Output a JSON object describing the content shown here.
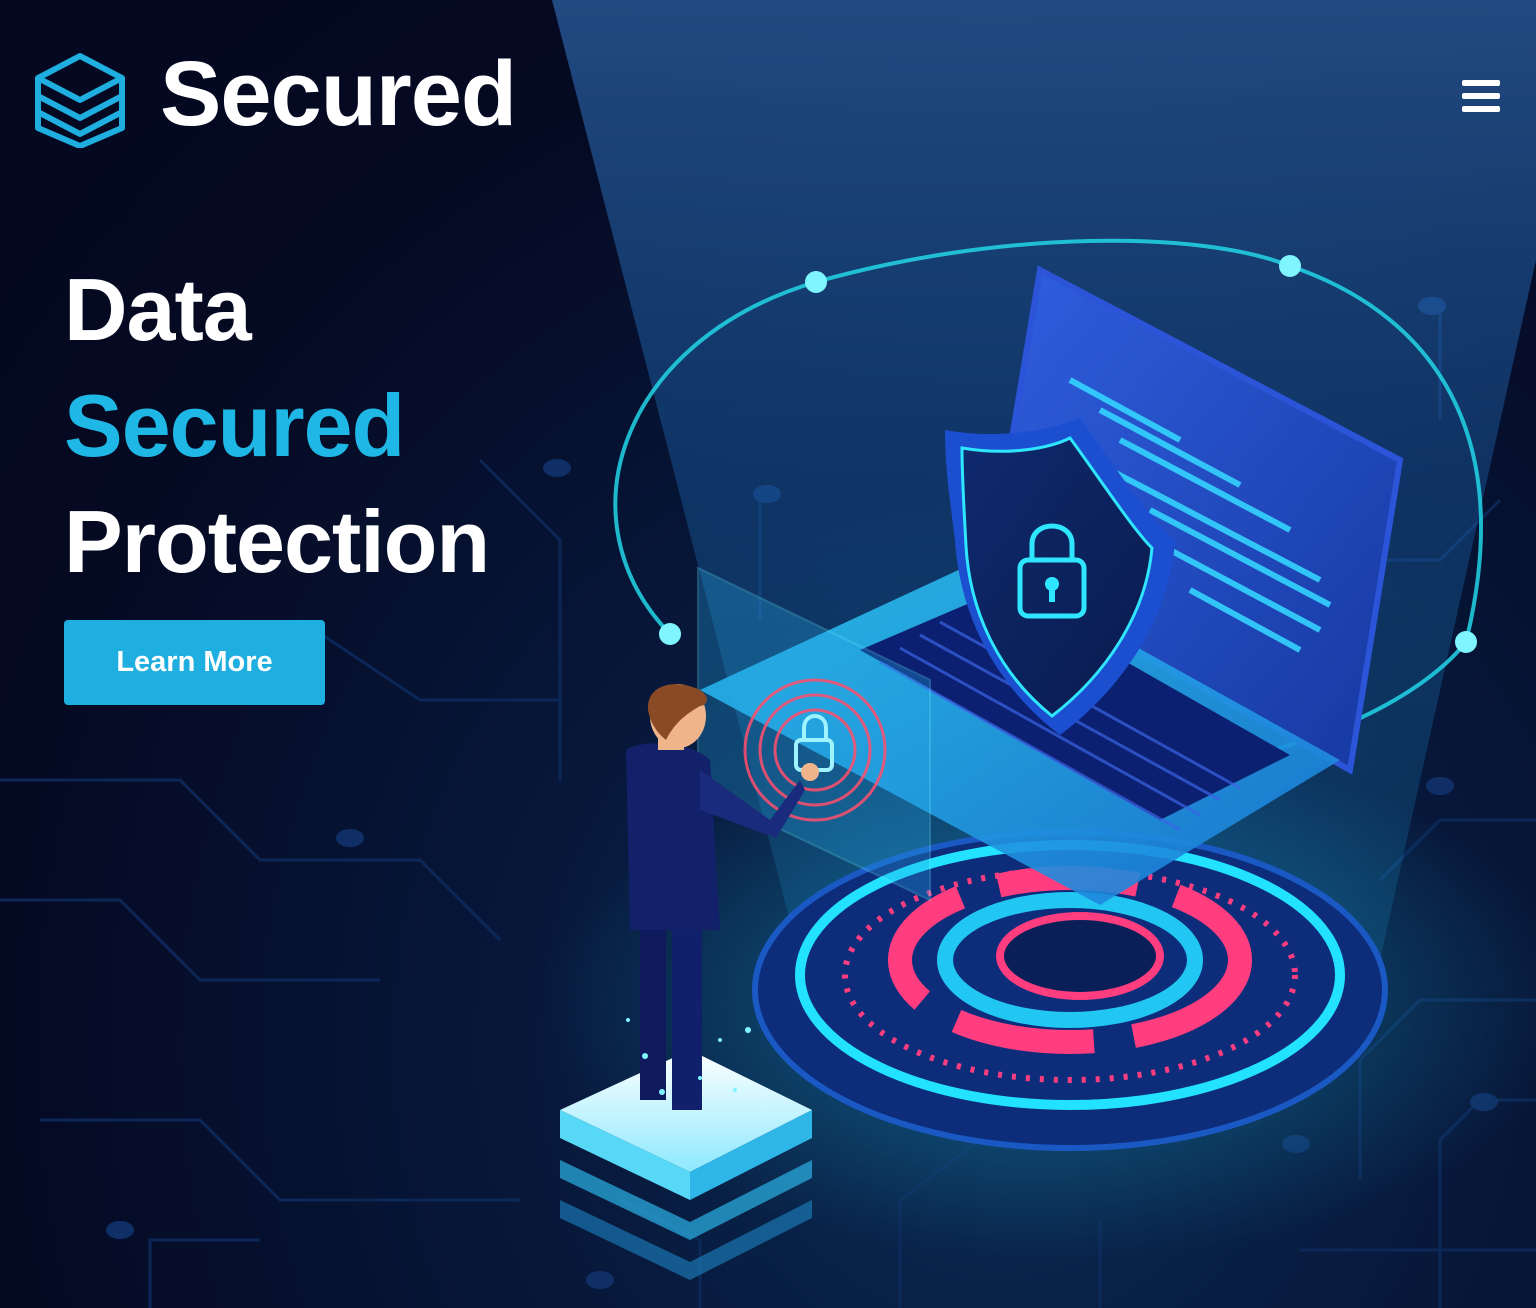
{
  "header": {
    "brand_name": "Secured",
    "logo_icon": "stacked-layers-icon",
    "menu_icon": "hamburger-menu-icon"
  },
  "hero": {
    "headline": {
      "line1": "Data",
      "line2": "Secured",
      "line3": "Protection"
    },
    "cta_label": "Learn More",
    "illustration": {
      "shield_icon": "shield-lock-icon",
      "fingerprint_icon": "fingerprint-lock-icon"
    }
  },
  "colors": {
    "background": "#050a23",
    "accent": "#1fb8e6",
    "button": "#1eaedf",
    "glow_cyan": "#2ee6ff",
    "ring_pink": "#ff3d7f",
    "laptop_blue": "#1c3fae"
  }
}
